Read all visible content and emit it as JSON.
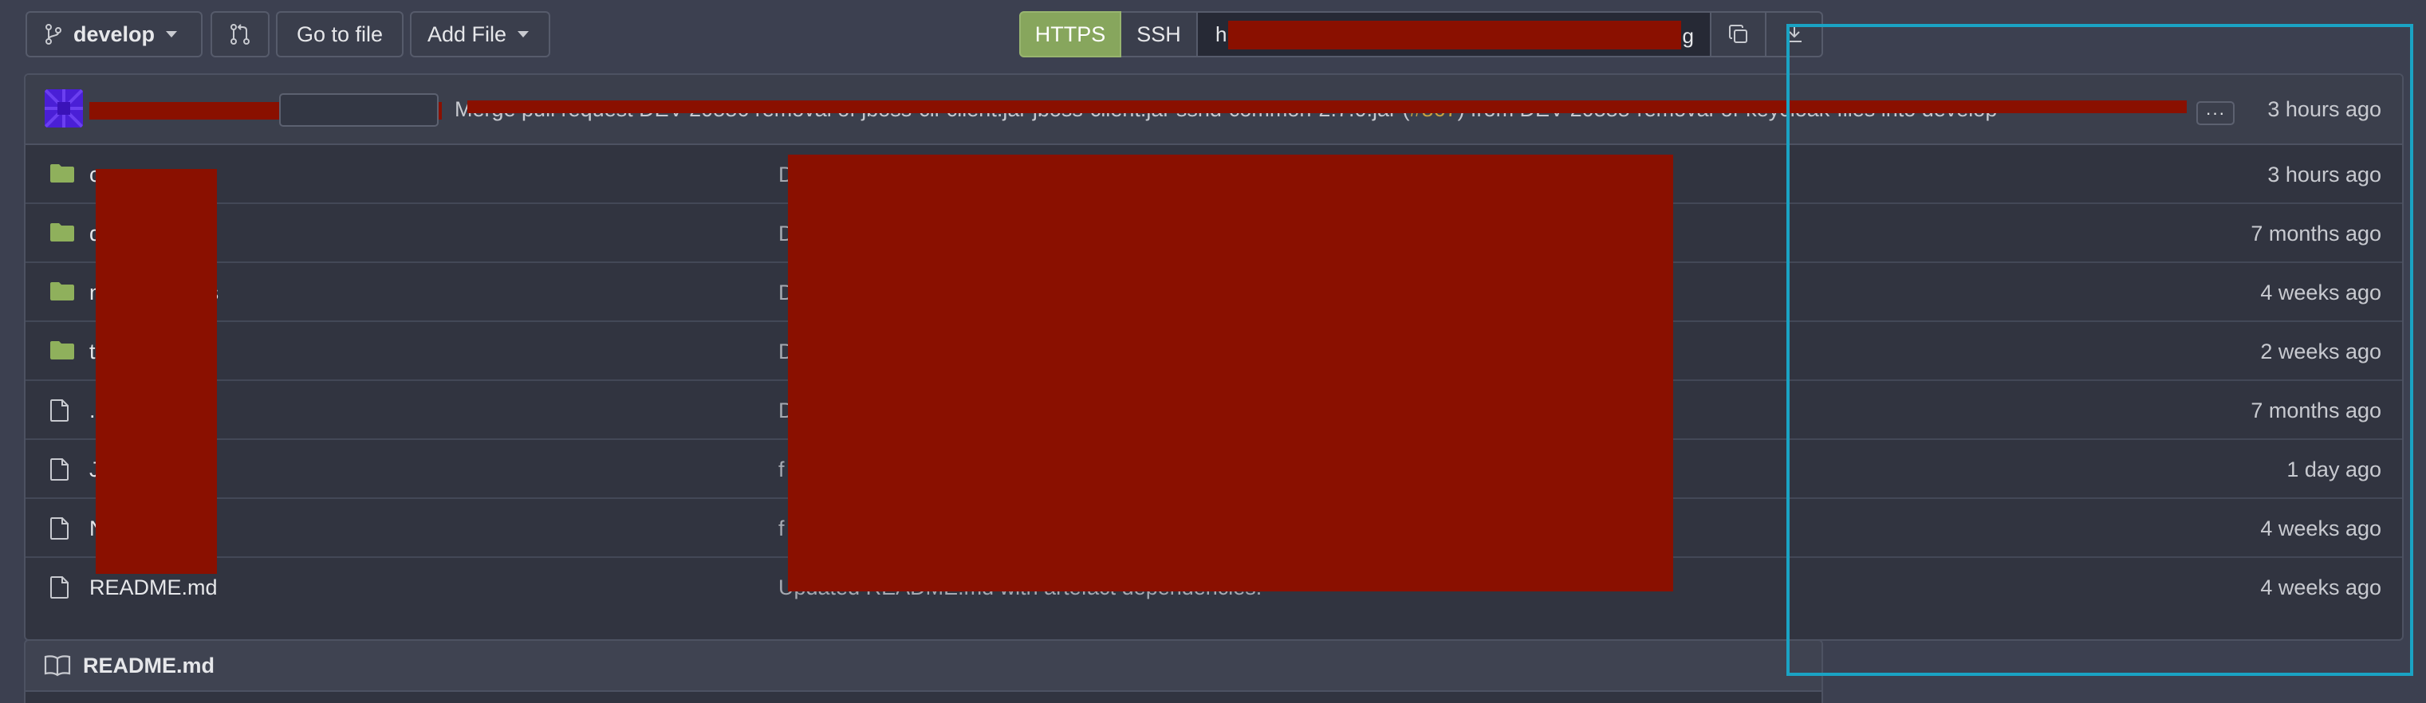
{
  "toolbar": {
    "branch_label": "develop",
    "branch_icon": "git-branch-icon",
    "compare_icon": "git-pull-request-icon",
    "goto_file_label": "Go to file",
    "add_file_label": "Add File"
  },
  "clone": {
    "https_label": "HTTPS",
    "ssh_label": "SSH",
    "url_start": "h",
    "url_end": "g",
    "copy_icon": "copy-icon",
    "download_icon": "download-icon"
  },
  "latest_commit": {
    "sha_label": "",
    "message_prefix": "Merge pull request",
    "message_middle": " DEV-20886 removal of jboss-cli-client.jar jboss-client.jar sshd-common-2.7.0.jar (",
    "pr_number": "#867",
    "message_suffix": ") from DEV-20888-removal-of-keycloak-files into develop",
    "more_label": "···",
    "time": "3 hours ago"
  },
  "files": [
    {
      "type": "folder",
      "name": "c",
      "commit": "D",
      "time": "3 hours ago"
    },
    {
      "type": "folder",
      "name": "d",
      "commit": "D",
      "time": "7 months ago"
    },
    {
      "type": "folder",
      "name": "maven-hooks",
      "commit": "D",
      "time": "4 weeks ago"
    },
    {
      "type": "folder",
      "name": "t",
      "commit": "D",
      "time": "2 weeks ago"
    },
    {
      "type": "file",
      "name": ".",
      "commit": "D",
      "time": "7 months ago"
    },
    {
      "type": "file",
      "name": "J",
      "commit": "f",
      "time": "1 day ago"
    },
    {
      "type": "file",
      "name": "N",
      "commit": "f",
      "time": "4 weeks ago"
    },
    {
      "type": "file",
      "name": "README.md",
      "commit": "Updated README.md with artefact dependencies.",
      "time": "4 weeks ago"
    }
  ],
  "readme": {
    "icon": "book-open-icon",
    "title": "README.md"
  },
  "colors": {
    "https_active": "#87a65d",
    "folder": "#8fb05c",
    "redaction": "#8a1000",
    "highlight": "#1aa3c4",
    "pr_link": "#c9a441"
  }
}
